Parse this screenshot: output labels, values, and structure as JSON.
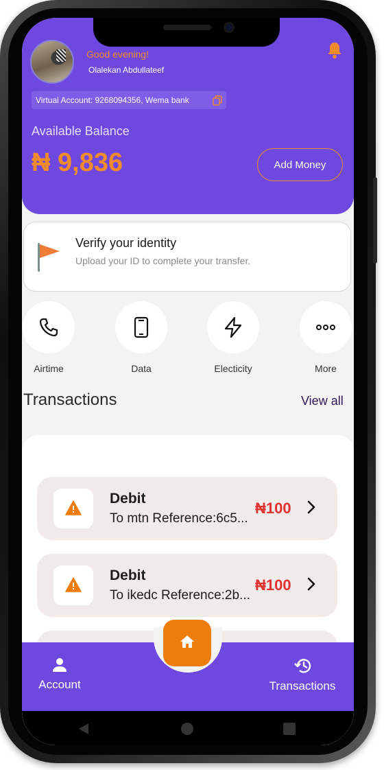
{
  "header": {
    "greeting": "Good evening!",
    "username": "Olalekan Abdullateef",
    "virtual_account": "Virtual Account: 9268094356, Wema bank",
    "balance_label": "Available Balance",
    "balance_value": "₦ 9,836",
    "add_money_label": "Add Money"
  },
  "verify": {
    "title": "Verify your identity",
    "subtitle": "Upload your ID to complete your transfer."
  },
  "quick_actions": [
    {
      "label": "Airtime",
      "icon": "phone-icon"
    },
    {
      "label": "Data",
      "icon": "mobile-device-icon"
    },
    {
      "label": "Electicity",
      "icon": "lightning-icon"
    },
    {
      "label": "More",
      "icon": "more-dots-icon"
    }
  ],
  "transactions": {
    "title": "Transactions",
    "view_all": "View all",
    "items": [
      {
        "type": "Debit",
        "description": "To mtn Reference:6c5...",
        "amount": "₦100"
      },
      {
        "type": "Debit",
        "description": "To ikedc Reference:2b...",
        "amount": "₦100"
      }
    ]
  },
  "bottom_nav": {
    "account_label": "Account",
    "transactions_label": "Transactions"
  },
  "colors": {
    "primary": "#6f48df",
    "accent": "#ef8b2c",
    "debit": "#e0322f"
  }
}
